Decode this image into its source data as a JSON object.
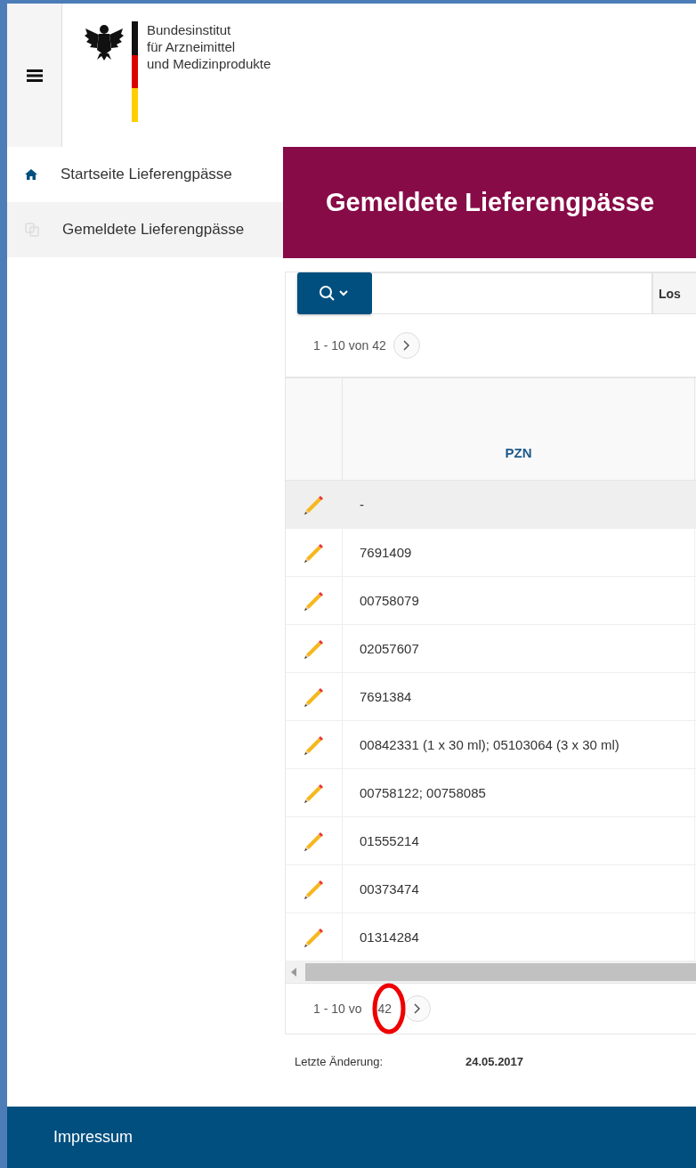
{
  "header": {
    "logo_lines": [
      "Bundesinstitut",
      "für Arzneimittel",
      "und Medizinprodukte"
    ]
  },
  "sidebar": {
    "items": [
      {
        "label": "Startseite Lieferengpässe",
        "kind": "home",
        "selected": false
      },
      {
        "label": "Gemeldete Lieferengpässe",
        "kind": "reports",
        "selected": true
      }
    ]
  },
  "banner": {
    "title": "Gemeldete Lieferengpässe"
  },
  "search": {
    "go_button": "Los"
  },
  "pagination_top": {
    "range": "1 - 10 von 42"
  },
  "table": {
    "columns": [
      "PZN"
    ],
    "rows": [
      {
        "pzn": "-",
        "highlighted": true
      },
      {
        "pzn": "7691409",
        "highlighted": false
      },
      {
        "pzn": "00758079",
        "highlighted": false
      },
      {
        "pzn": "02057607",
        "highlighted": false
      },
      {
        "pzn": "7691384",
        "highlighted": false
      },
      {
        "pzn": "00842331 (1 x 30 ml); 05103064 (3 x 30 ml)",
        "highlighted": false
      },
      {
        "pzn": "00758122; 00758085",
        "highlighted": false
      },
      {
        "pzn": "01555214",
        "highlighted": false
      },
      {
        "pzn": "00373474",
        "highlighted": false
      },
      {
        "pzn": "01314284",
        "highlighted": false
      }
    ]
  },
  "pagination_bottom": {
    "range_parts": [
      "1 - 10 vo",
      "42"
    ],
    "annotated": true
  },
  "last_change": {
    "label": "Letzte Änderung:",
    "date": "24.05.2017"
  },
  "footer": {
    "link": "Impressum"
  }
}
